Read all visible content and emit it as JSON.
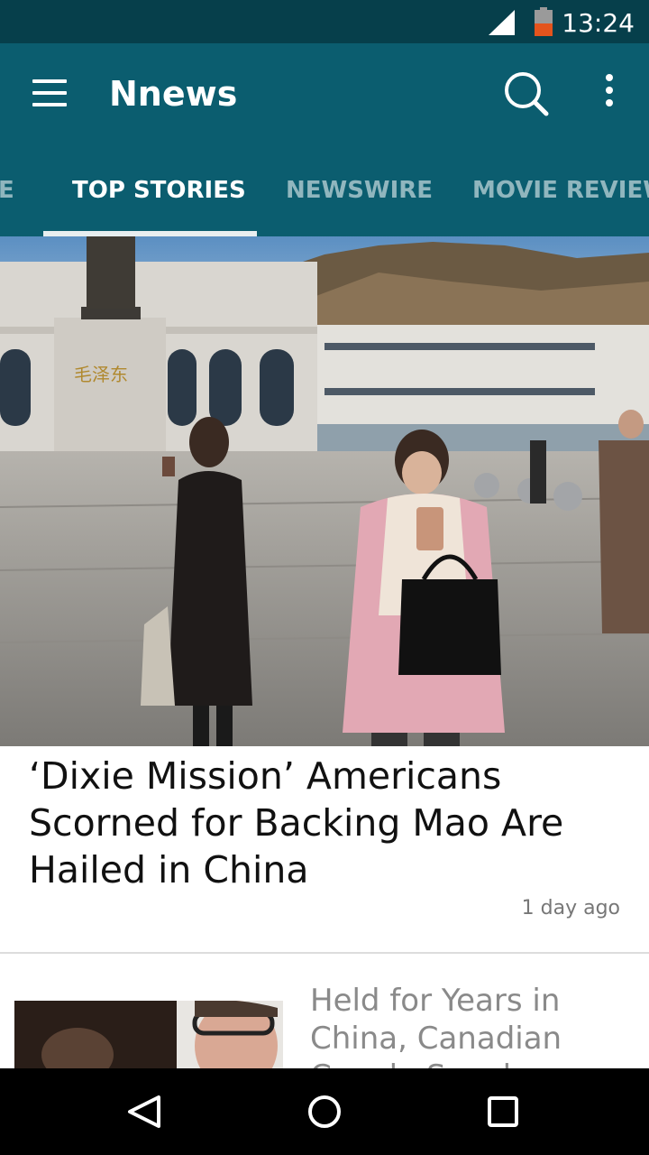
{
  "status_bar": {
    "time": "13:24",
    "battery_level": "11"
  },
  "app_bar": {
    "title": "Nnews"
  },
  "tabs": [
    {
      "label": "E"
    },
    {
      "label": "TOP STORIES"
    },
    {
      "label": "NEWSWIRE"
    },
    {
      "label": "MOVIE REVIEWS"
    }
  ],
  "stories": [
    {
      "title": "‘Dixie Mission’ Americans Scorned for Backing Mao Are Hailed in China",
      "time": "1 day ago"
    },
    {
      "title": "Held for Years in China, Canadian Couple Speak"
    }
  ],
  "colors": {
    "status_bar": "#063f4b",
    "app_bar": "#0b5d6f",
    "nav_bar": "#000000"
  }
}
